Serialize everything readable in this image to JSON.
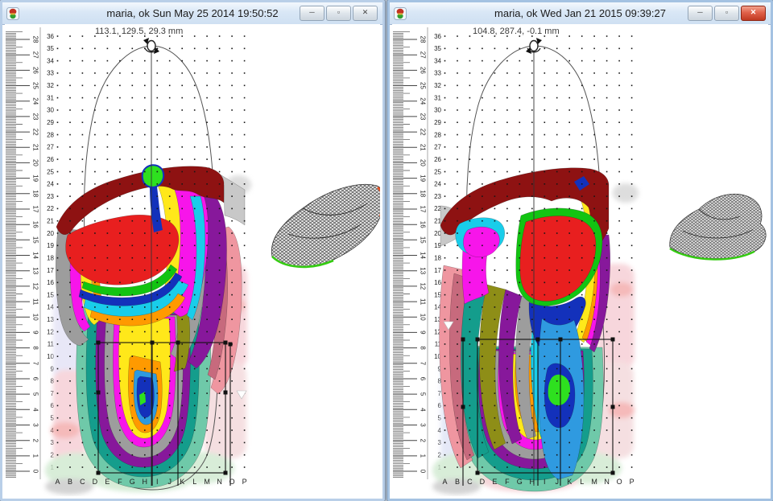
{
  "windows": [
    {
      "side": "left",
      "title": "maria, ok  Sun May 25 2014 19:50:52",
      "coords": "113.1, 129.5, 29.3 mm",
      "active": false,
      "buttons": {
        "minimize": "─",
        "maximize": "▫",
        "close": "✕"
      }
    },
    {
      "side": "right",
      "title": "maria, ok  Wed Jan 21 2015 09:39:27",
      "coords": "104.8, 287.4, -0.1 mm",
      "active": true,
      "buttons": {
        "minimize": "─",
        "maximize": "▫",
        "close": "✕"
      }
    }
  ],
  "ruler": {
    "cm_labels": [
      "28",
      "27",
      "26",
      "25",
      "24",
      "23",
      "22",
      "21",
      "20",
      "19",
      "18",
      "17",
      "16",
      "15",
      "14",
      "13",
      "12",
      "11",
      "10",
      "9",
      "8",
      "7",
      "6",
      "5",
      "4",
      "3",
      "2",
      "1",
      "0"
    ],
    "row_numbers": [
      "36",
      "35",
      "34",
      "33",
      "32",
      "31",
      "30",
      "29",
      "28",
      "27",
      "26",
      "25",
      "24",
      "23",
      "22",
      "21",
      "20",
      "19",
      "18",
      "17",
      "16",
      "15",
      "14",
      "13",
      "12",
      "11",
      "10",
      "9",
      "8",
      "7",
      "6",
      "5",
      "4",
      "3",
      "2",
      "1"
    ],
    "col_letters": [
      "A",
      "B",
      "C",
      "D",
      "E",
      "F",
      "G",
      "H",
      "I",
      "J",
      "K",
      "L",
      "M",
      "N",
      "O",
      "P"
    ]
  },
  "palette": {
    "pressure_high": "#8e1212",
    "red": "#e81f1f",
    "orange": "#ff9a00",
    "yellow": "#ffe81a",
    "green": "#12c412",
    "cyan": "#19cdea",
    "sky_blue": "#2f9ae0",
    "blue": "#1331bb",
    "magenta": "#f715ea",
    "purple": "#87189b",
    "olive": "#8e8e17",
    "teal": "#149d8c",
    "teal_light": "#6fc9a9",
    "gray_band": "#9d9d9d",
    "salmon": "#ef96a0",
    "mesh_edge_green": "#35cc12",
    "mesh_edge_orange": "#e85424"
  }
}
